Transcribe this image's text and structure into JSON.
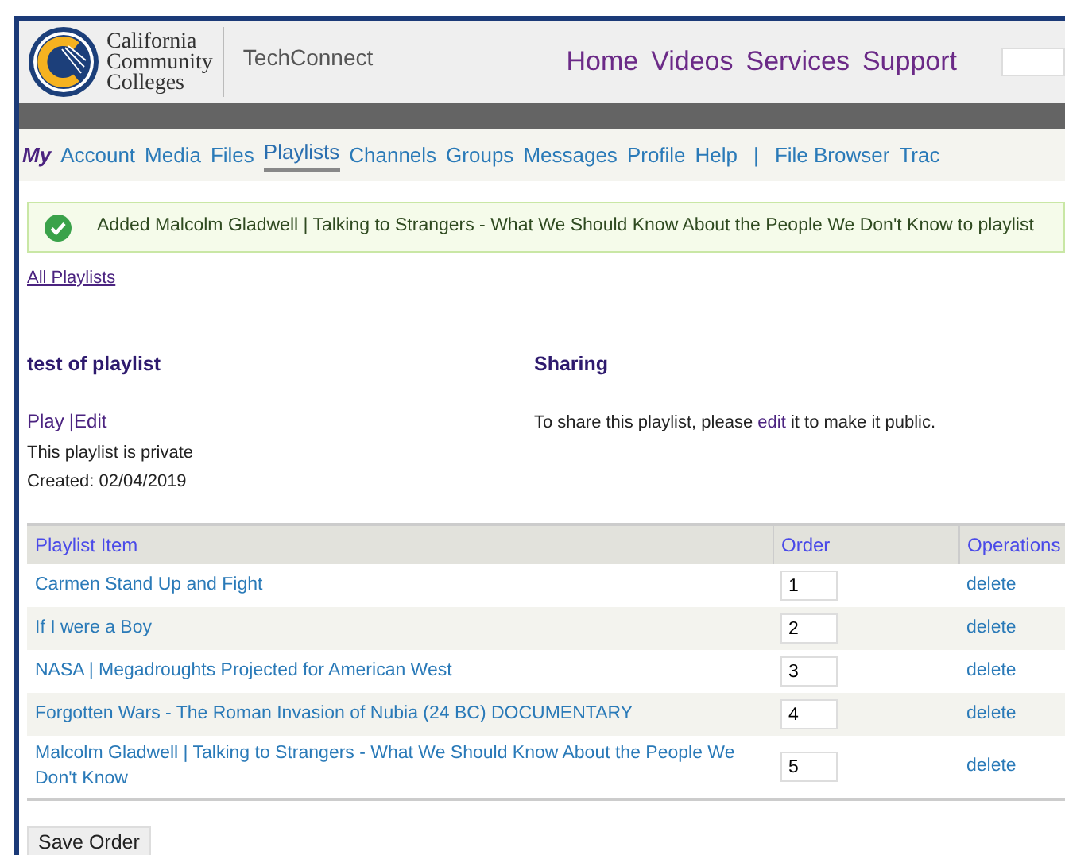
{
  "header": {
    "logo_text": [
      "California",
      "Community",
      "Colleges"
    ],
    "site_name": "TechConnect",
    "top_links": [
      "Home",
      "Videos",
      "Services",
      "Support"
    ]
  },
  "subnav": {
    "prefix": "My",
    "items": [
      {
        "label": "Account",
        "selected": false
      },
      {
        "label": "Media",
        "selected": false
      },
      {
        "label": "Files",
        "selected": false
      },
      {
        "label": "Playlists",
        "selected": true
      },
      {
        "label": "Channels",
        "selected": false
      },
      {
        "label": "Groups",
        "selected": false
      },
      {
        "label": "Messages",
        "selected": false
      },
      {
        "label": "Profile",
        "selected": false
      },
      {
        "label": "Help",
        "selected": false
      }
    ],
    "separator": "|",
    "extra_items": [
      "File Browser",
      "Trac"
    ]
  },
  "alert": {
    "kind": "success",
    "text": "Added Malcolm Gladwell | Talking to Strangers - What We Should Know About the People We Don't Know to playlist"
  },
  "back_link": "All Playlists",
  "playlist": {
    "title": "test of playlist",
    "play_link": "Play",
    "separator": "|",
    "edit_link": "Edit",
    "privacy": "This playlist is private",
    "created": "Created: 02/04/2019"
  },
  "sharing": {
    "title": "Sharing",
    "text_before": "To share this playlist, please",
    "link": "edit",
    "text_after": "it to make it public."
  },
  "table": {
    "columns": [
      "Playlist Item",
      "Order",
      "Operations"
    ],
    "rows": [
      {
        "item": "Carmen Stand Up and Fight",
        "order": "1",
        "operation": "delete"
      },
      {
        "item": "If I were a Boy",
        "order": "2",
        "operation": "delete"
      },
      {
        "item": "NASA | Megadroughts Projected for American West",
        "order": "3",
        "operation": "delete"
      },
      {
        "item": "Forgotten Wars - The Roman Invasion of Nubia (24 BC) DOCUMENTARY",
        "order": "4",
        "operation": "delete"
      },
      {
        "item": "Malcolm Gladwell | Talking to Strangers - What We Should Know About the People We Don't Know",
        "order": "5",
        "operation": "delete"
      }
    ]
  },
  "save_button": "Save Order"
}
